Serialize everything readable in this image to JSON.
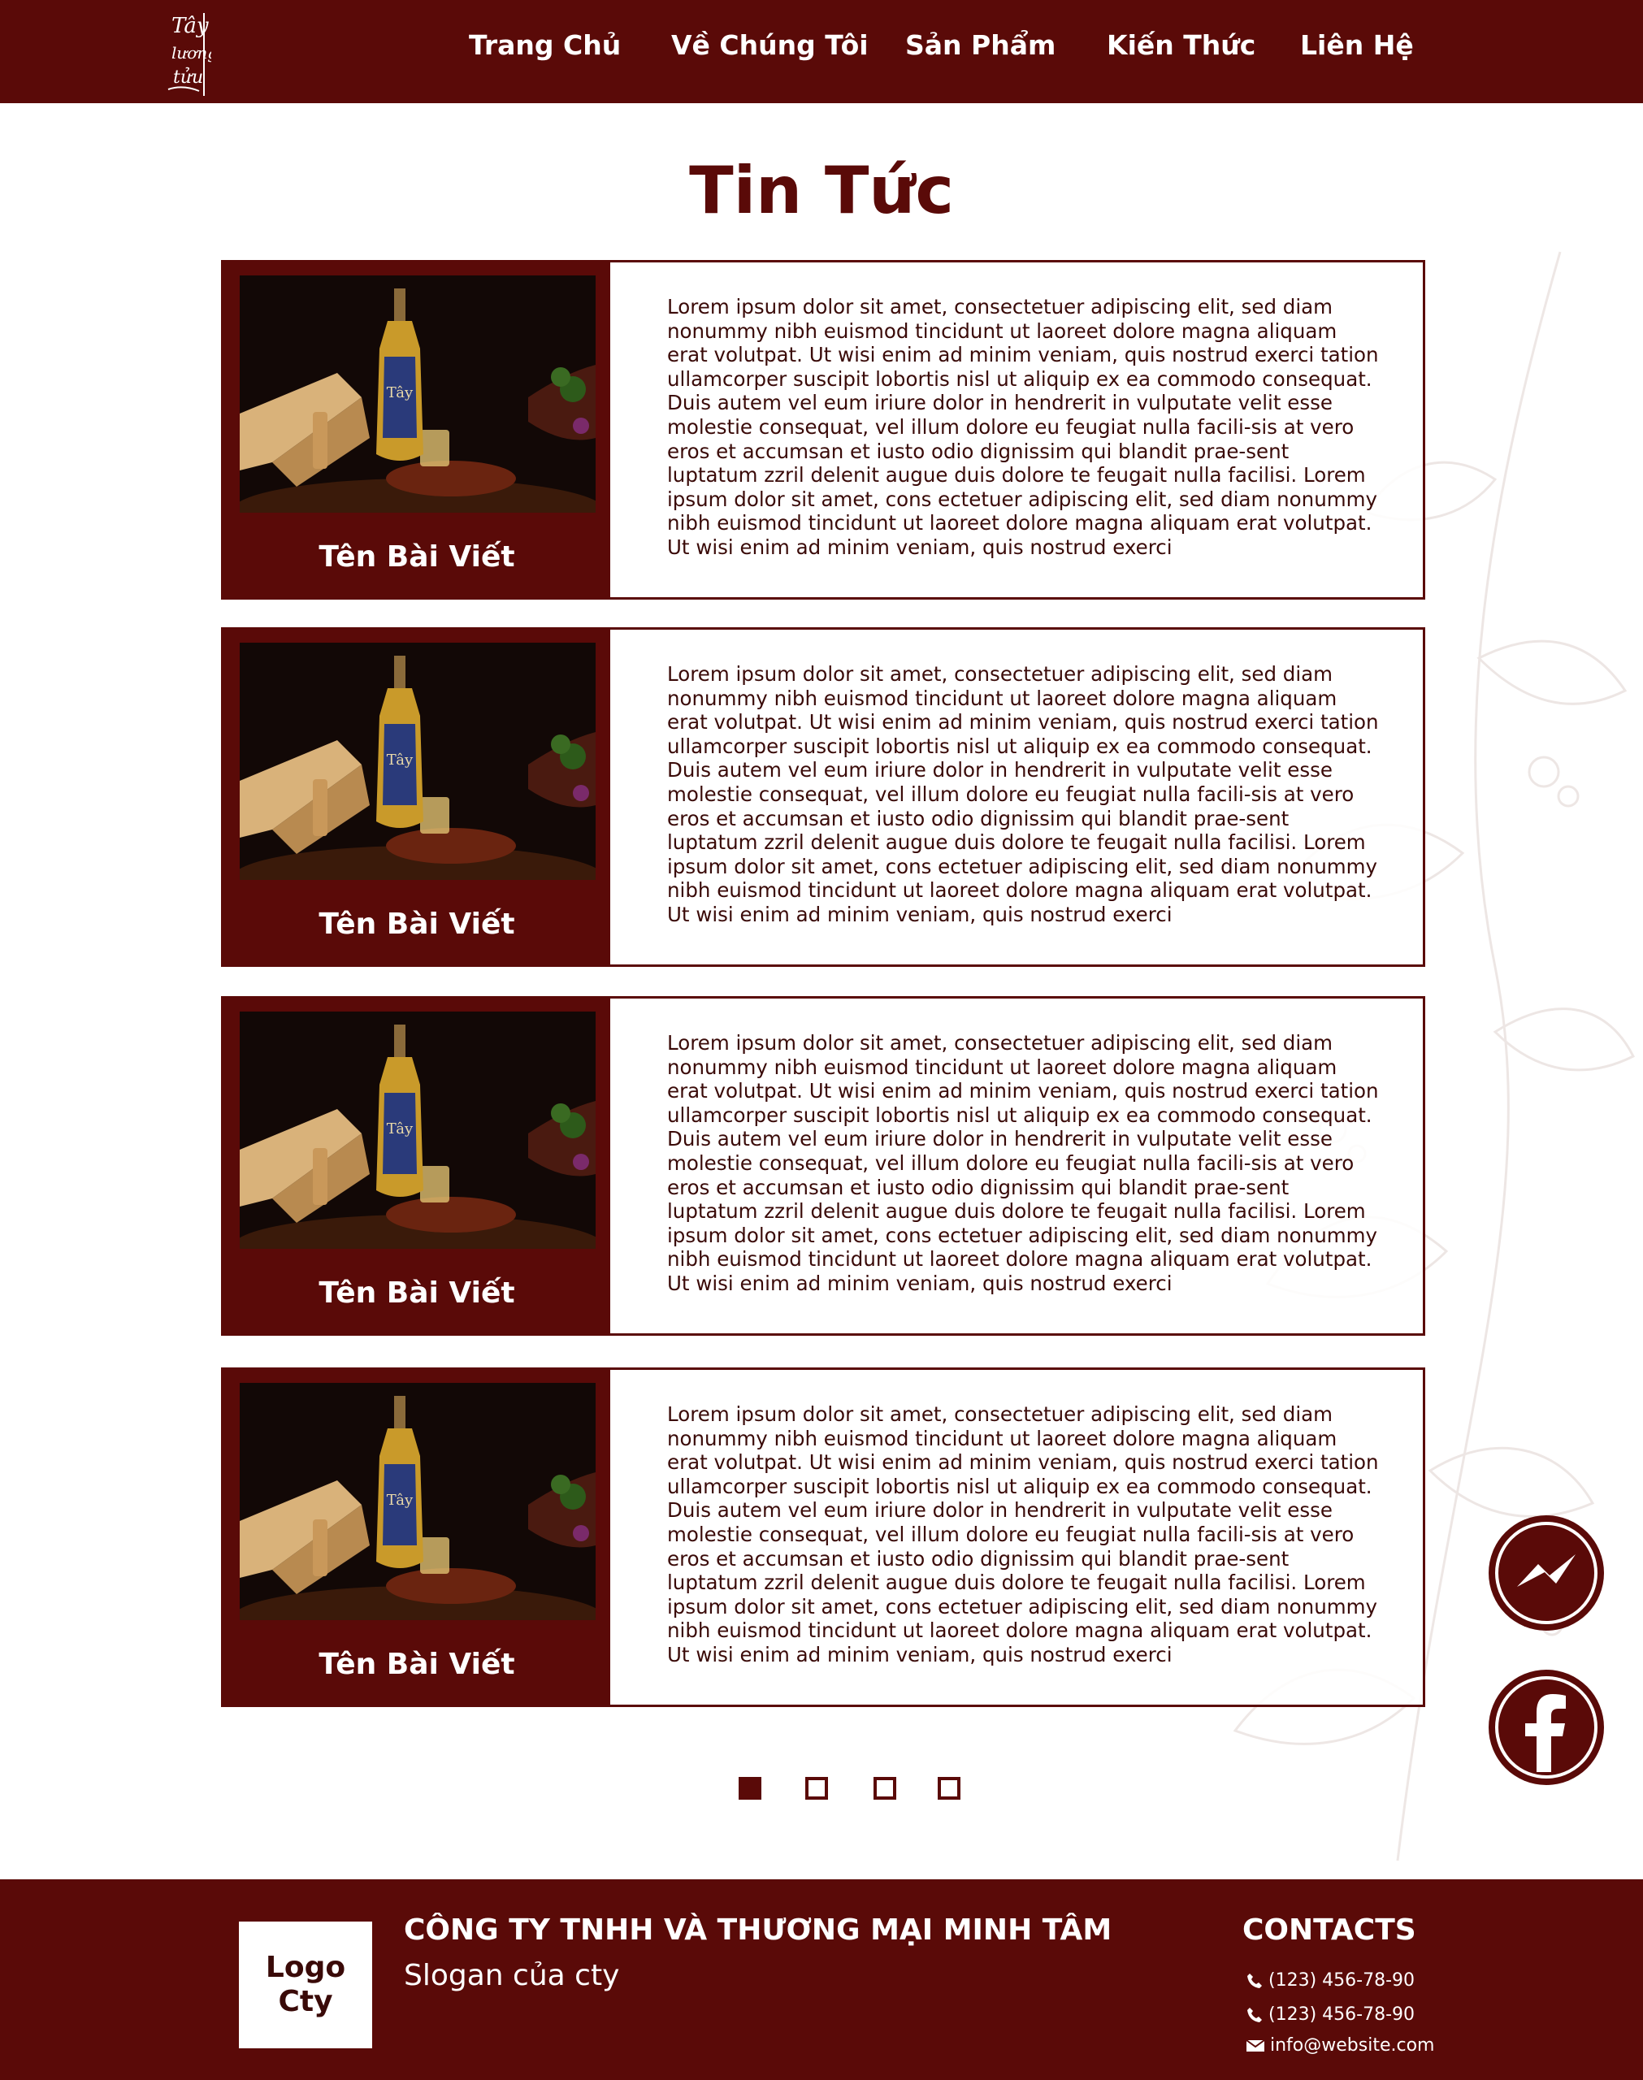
{
  "nav": {
    "logo_text": "Tây Lương Tửu",
    "items": [
      {
        "label": "Trang Chủ"
      },
      {
        "label": "Về Chúng Tôi"
      },
      {
        "label": "Sản Phẩm"
      },
      {
        "label": "Kiến Thức"
      },
      {
        "label": "Liên Hệ"
      }
    ]
  },
  "page": {
    "title": "Tin Tức"
  },
  "posts": [
    {
      "title": "Tên Bài Viết",
      "body": "Lorem ipsum dolor sit amet, consectetuer adipiscing elit, sed diam nonummy nibh euismod tincidunt ut laoreet dolore magna aliquam erat volutpat. Ut wisi enim ad minim veniam, quis nostrud exerci tation ullamcorper suscipit lobortis nisl ut aliquip ex ea commodo consequat. Duis autem vel eum iriure dolor in hendrerit in vulputate velit esse molestie consequat, vel illum dolore eu feugiat nulla facili-sis at vero eros et accumsan et iusto odio dignissim qui blandit prae-sent luptatum zzril delenit augue duis dolore te feugait nulla facilisi. Lorem ipsum dolor sit amet, cons ectetuer adipiscing elit, sed diam nonummy nibh euismod tincidunt ut laoreet dolore magna aliquam erat volutpat. Ut wisi enim ad minim veniam, quis nostrud exerci"
    },
    {
      "title": "Tên Bài Viết",
      "body": "Lorem ipsum dolor sit amet, consectetuer adipiscing elit, sed diam nonummy nibh euismod tincidunt ut laoreet dolore magna aliquam erat volutpat. Ut wisi enim ad minim veniam, quis nostrud exerci tation ullamcorper suscipit lobortis nisl ut aliquip ex ea commodo consequat. Duis autem vel eum iriure dolor in hendrerit in vulputate velit esse molestie consequat, vel illum dolore eu feugiat nulla facili-sis at vero eros et accumsan et iusto odio dignissim qui blandit prae-sent luptatum zzril delenit augue duis dolore te feugait nulla facilisi. Lorem ipsum dolor sit amet, cons ectetuer adipiscing elit, sed diam nonummy nibh euismod tincidunt ut laoreet dolore magna aliquam erat volutpat. Ut wisi enim ad minim veniam, quis nostrud exerci"
    },
    {
      "title": "Tên Bài Viết",
      "body": "Lorem ipsum dolor sit amet, consectetuer adipiscing elit, sed diam nonummy nibh euismod tincidunt ut laoreet dolore magna aliquam erat volutpat. Ut wisi enim ad minim veniam, quis nostrud exerci tation ullamcorper suscipit lobortis nisl ut aliquip ex ea commodo consequat. Duis autem vel eum iriure dolor in hendrerit in vulputate velit esse molestie consequat, vel illum dolore eu feugiat nulla facili-sis at vero eros et accumsan et iusto odio dignissim qui blandit prae-sent luptatum zzril delenit augue duis dolore te feugait nulla facilisi. Lorem ipsum dolor sit amet, cons ectetuer adipiscing elit, sed diam nonummy nibh euismod tincidunt ut laoreet dolore magna aliquam erat volutpat. Ut wisi enim ad minim veniam, quis nostrud exerci"
    },
    {
      "title": "Tên Bài Viết",
      "body": "Lorem ipsum dolor sit amet, consectetuer adipiscing elit, sed diam nonummy nibh euismod tincidunt ut laoreet dolore magna aliquam erat volutpat. Ut wisi enim ad minim veniam, quis nostrud exerci tation ullamcorper suscipit lobortis nisl ut aliquip ex ea commodo consequat. Duis autem vel eum iriure dolor in hendrerit in vulputate velit esse molestie consequat, vel illum dolore eu feugiat nulla facili-sis at vero eros et accumsan et iusto odio dignissim qui blandit prae-sent luptatum zzril delenit augue duis dolore te feugait nulla facilisi. Lorem ipsum dolor sit amet, cons ectetuer adipiscing elit, sed diam nonummy nibh euismod tincidunt ut laoreet dolore magna aliquam erat volutpat. Ut wisi enim ad minim veniam, quis nostrud exerci"
    }
  ],
  "pagination": {
    "total": 4,
    "current": 1
  },
  "floating": {
    "messenger_icon": "messenger-icon",
    "facebook_icon": "facebook-icon"
  },
  "footer": {
    "logo_text": "Logo\nCty",
    "company_name": "CÔNG TY TNHH VÀ THƯƠNG MẠI MINH TÂM",
    "slogan": "Slogan của cty",
    "contacts_heading": "CONTACTS",
    "phone_1": "(123) 456-78-90",
    "phone_2": "(123) 456-78-90",
    "email": "info@website.com"
  },
  "colors": {
    "brand": "#5a0a08",
    "text": "#3a0a08",
    "background": "#ffffff"
  }
}
